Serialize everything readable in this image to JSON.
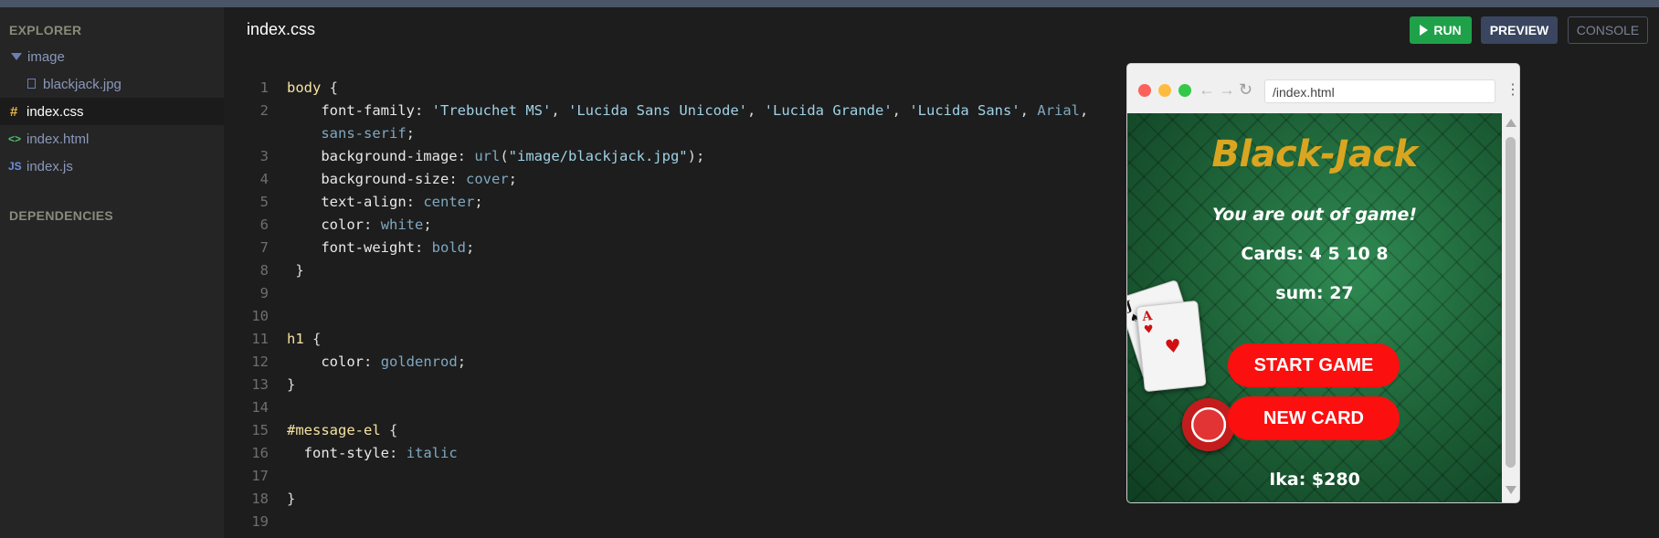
{
  "sidebar": {
    "explorer_label": "EXPLORER",
    "dependencies_label": "DEPENDENCIES",
    "items": [
      {
        "label": "image",
        "icon": "folder-caret-icon"
      },
      {
        "label": "blackjack.jpg",
        "icon": "file-icon"
      },
      {
        "label": "index.css",
        "icon": "#"
      },
      {
        "label": "index.html",
        "icon": "<>"
      },
      {
        "label": "index.js",
        "icon": "JS"
      }
    ]
  },
  "editor": {
    "tab_title": "index.css",
    "line_numbers": [
      "1",
      "2",
      "",
      "3",
      "4",
      "5",
      "6",
      "7",
      "8",
      "9",
      "10",
      "11",
      "12",
      "13",
      "14",
      "15",
      "16",
      "17",
      "18",
      "19"
    ]
  },
  "toolbar": {
    "run_label": "RUN",
    "preview_label": "PREVIEW",
    "console_label": "CONSOLE"
  },
  "browser": {
    "url": "/index.html"
  },
  "game": {
    "title": "Black-Jack",
    "message": "You are out of game!",
    "cards": "Cards: 4 5 10 8",
    "sum": "sum: 27",
    "start_button": "START GAME",
    "new_card_button": "NEW CARD",
    "player": "Ika: $280"
  },
  "colors": {
    "run": "#1fa14a",
    "preview": "#3a4660",
    "title_gold": "#daa520",
    "button_red": "#fb0f0f"
  }
}
